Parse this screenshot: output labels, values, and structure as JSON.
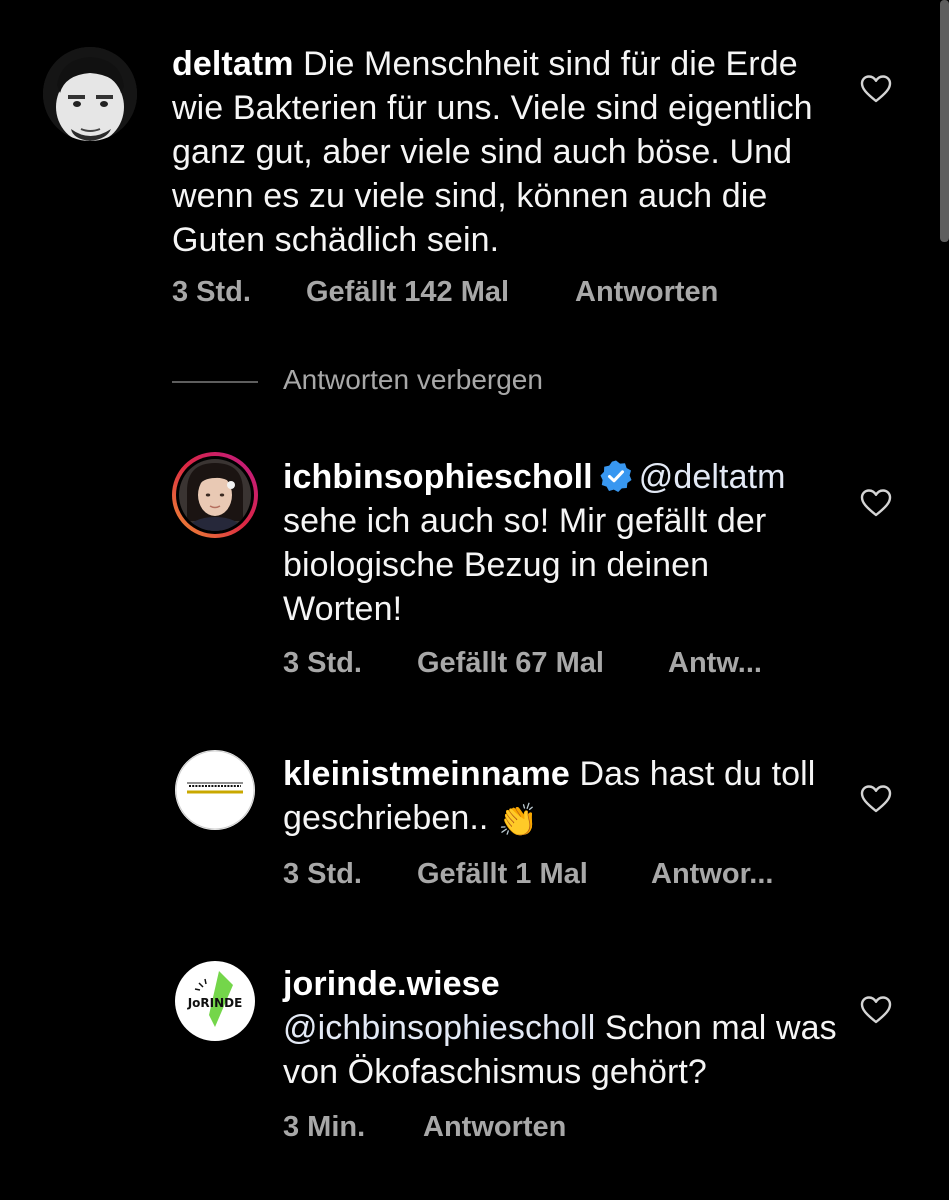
{
  "hide_replies_label": "Antworten verbergen",
  "comments": [
    {
      "username": "deltatm",
      "text": "Die Menschheit sind für die Erde wie Bakterien für uns. Viele sind eigentlich ganz gut, aber viele sind auch böse. Und wenn es zu viele sind, können auch die Guten schädlich sein.",
      "time": "3 Std.",
      "likes": "Gefällt 142 Mal",
      "reply": "Antworten",
      "avatar_icon": "man-portrait-avatar"
    },
    {
      "username": "ichbinsophiescholl",
      "verified": true,
      "mention": "@deltatm",
      "text": "sehe ich auch so! Mir gefällt der biologische Bezug in deinen Worten!",
      "time": "3 Std.",
      "likes": "Gefällt 67 Mal",
      "reply": "Antw...",
      "avatar_icon": "woman-portrait-avatar-story-ring"
    },
    {
      "username": "kleinistmeinname",
      "text": "Das hast du toll geschrieben..",
      "emoji": "👏",
      "time": "3 Std.",
      "likes": "Gefällt 1 Mal",
      "reply": "Antwor...",
      "avatar_icon": "kleinistmeinname-logo-avatar"
    },
    {
      "username": "jorinde.wiese",
      "mention": "@ichbinsophiescholl",
      "text": "Schon mal was von Ökofaschismus gehört?",
      "time": "3 Min.",
      "reply": "Antworten",
      "avatar_icon": "jorinde-logo-avatar",
      "avatar_logo_text": "JoRINDE"
    }
  ],
  "colors": {
    "background": "#000000",
    "text": "#f5f5f5",
    "meta_text": "#a8a8a8",
    "verified_badge": "#3897f0",
    "story_ring_start": "#f09433",
    "story_ring_end": "#bc1888"
  }
}
